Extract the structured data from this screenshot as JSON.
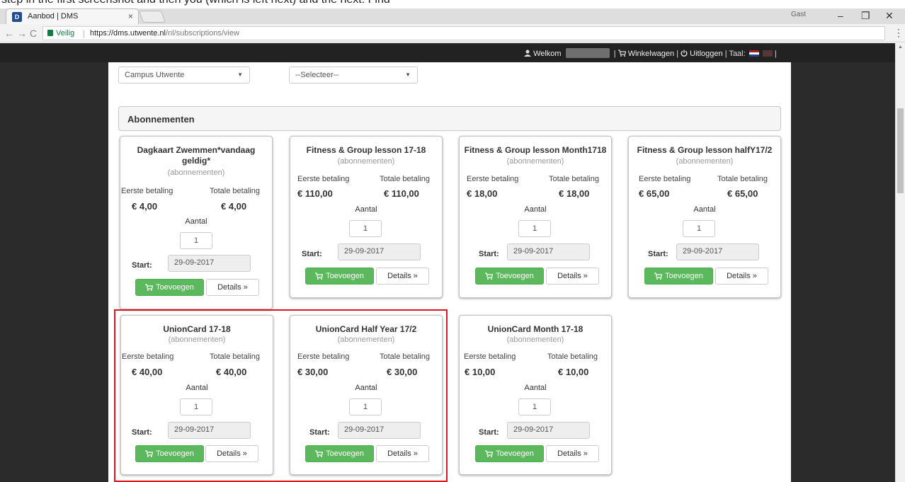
{
  "top_strip": {
    "text": "step in the first screenshot and then you (which is left next) and the next: Find"
  },
  "browser": {
    "tab_title": "Aanbod | DMS",
    "tab_close": "×",
    "window_user": "Gast",
    "window_controls": [
      "–",
      "❐",
      "✕"
    ],
    "nav": {
      "back": "←",
      "forward": "→",
      "reload": "C"
    },
    "secure_label": "Veilig",
    "url": {
      "host": "https://dms.utwente.nl",
      "path": "/nl/subscriptions/view"
    },
    "menu": "⋮"
  },
  "header": {
    "welcome": "Welkom",
    "cart": "Winkelwagen",
    "logout": "Uitloggen",
    "language": "Taal:",
    "separator": "|"
  },
  "filters": {
    "location_value": "Campus Utwente",
    "category_value": "--Selecteer--"
  },
  "section": {
    "title": "Abonnementen"
  },
  "labels": {
    "eerste": "Eerste betaling",
    "totale": "Totale betaling",
    "aantal": "Aantal",
    "start": "Start:",
    "add": "Toevoegen",
    "details": "Details »"
  },
  "cards": [
    {
      "title": "Dagkaart Zwemmen*vandaag geldig*",
      "subtitle": "(abonnementen)",
      "first_payment": "€ 4,00",
      "total_payment": "€ 4,00",
      "quantity": "1",
      "start": "29-09-2017"
    },
    {
      "title": "Fitness & Group lesson 17-18",
      "subtitle": "(abonnementen)",
      "first_payment": "€ 110,00",
      "total_payment": "€ 110,00",
      "quantity": "1",
      "start": "29-09-2017"
    },
    {
      "title": "Fitness & Group lesson Month1718",
      "subtitle": "(abonnementen)",
      "first_payment": "€ 18,00",
      "total_payment": "€ 18,00",
      "quantity": "1",
      "start": "29-09-2017"
    },
    {
      "title": "Fitness & Group lesson halfY17/2",
      "subtitle": "(abonnementen)",
      "first_payment": "€ 65,00",
      "total_payment": "€ 65,00",
      "quantity": "1",
      "start": "29-09-2017"
    },
    {
      "title": "UnionCard 17-18",
      "subtitle": "(abonnementen)",
      "first_payment": "€ 40,00",
      "total_payment": "€ 40,00",
      "quantity": "1",
      "start": "29-09-2017"
    },
    {
      "title": "UnionCard Half Year 17/2",
      "subtitle": "(abonnementen)",
      "first_payment": "€ 30,00",
      "total_payment": "€ 30,00",
      "quantity": "1",
      "start": "29-09-2017"
    },
    {
      "title": "UnionCard Month 17-18",
      "subtitle": "(abonnementen)",
      "first_payment": "€ 10,00",
      "total_payment": "€ 10,00",
      "quantity": "1",
      "start": "29-09-2017"
    }
  ],
  "colors": {
    "add_button": "#5cb85c",
    "highlight": "#e0141b",
    "header_bg": "#222222",
    "side_bg": "#2b2b2b"
  }
}
